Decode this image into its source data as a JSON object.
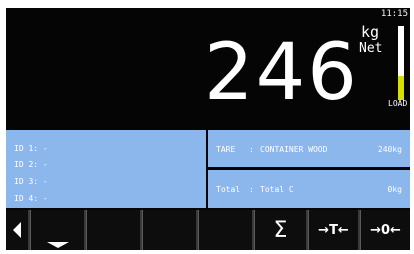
{
  "clock": "11:15",
  "weight": {
    "value": "246",
    "unit": "kg",
    "mode": "Net"
  },
  "load_indicator": {
    "label": "LOAD",
    "fill_fraction": 0.33,
    "fill_color": "#d8e000"
  },
  "ids": [
    {
      "label": "ID 1: -"
    },
    {
      "label": "ID 2: -"
    },
    {
      "label": "ID 3: -"
    },
    {
      "label": "ID 4: -"
    }
  ],
  "tare": {
    "label": "TARE",
    "separator": ":",
    "name": "CONTAINER WOOD",
    "value": "240kg"
  },
  "total": {
    "label": "Total",
    "separator": ":",
    "name": "Total C",
    "value": "0kg"
  },
  "function_keys": {
    "back": "back-arrow-icon",
    "keys": [
      {
        "name": "softkey-1",
        "icon": "underline-chevron-icon",
        "label": ""
      },
      {
        "name": "softkey-2",
        "icon": "",
        "label": ""
      },
      {
        "name": "softkey-3",
        "icon": "",
        "label": ""
      },
      {
        "name": "softkey-4",
        "icon": "",
        "label": ""
      },
      {
        "name": "sum-key",
        "icon": "sigma-icon",
        "label": "Σ"
      },
      {
        "name": "tare-key",
        "icon": "tare-icon",
        "label": "→T←"
      },
      {
        "name": "zero-key",
        "icon": "zero-icon",
        "label": "→0←"
      }
    ]
  },
  "colors": {
    "info_panel": "#8bb7ec",
    "screen_background": "#050505",
    "load_bar": "#ffffff"
  }
}
